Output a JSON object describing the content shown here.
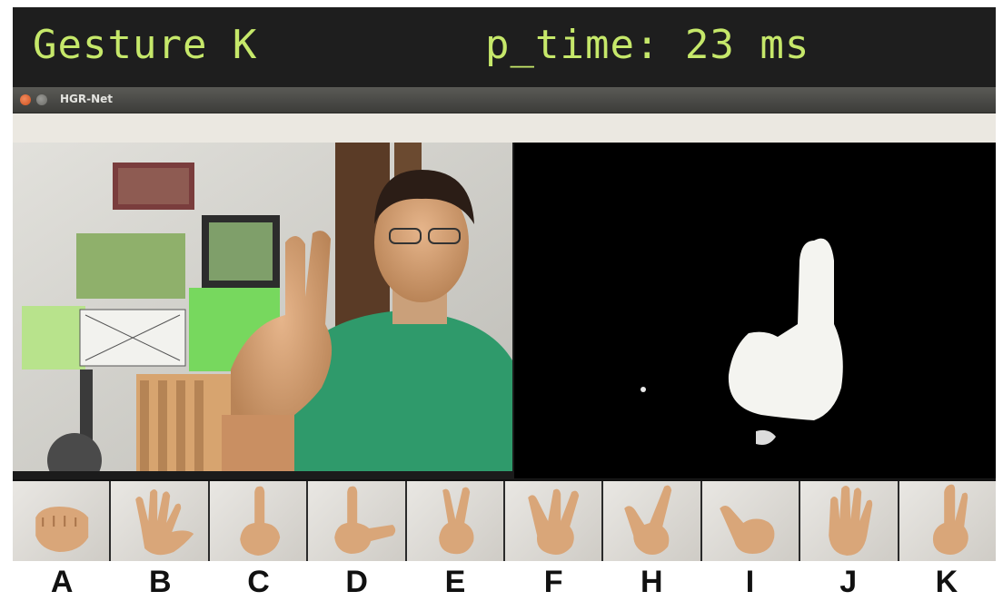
{
  "status": {
    "gesture_text": "Gesture K",
    "ptime_text": "p_time: 23 ms"
  },
  "window": {
    "title": "HGR-Net"
  },
  "gestures": [
    {
      "letter": "A",
      "icon": "fist-hand-icon"
    },
    {
      "letter": "B",
      "icon": "open-palm-icon"
    },
    {
      "letter": "C",
      "icon": "index-up-icon"
    },
    {
      "letter": "D",
      "icon": "l-shape-hand-icon"
    },
    {
      "letter": "E",
      "icon": "v-hand-icon"
    },
    {
      "letter": "F",
      "icon": "three-fingers-icon"
    },
    {
      "letter": "H",
      "icon": "horns-hand-icon"
    },
    {
      "letter": "I",
      "icon": "thumb-out-hand-icon"
    },
    {
      "letter": "J",
      "icon": "four-fingers-icon"
    },
    {
      "letter": "K",
      "icon": "two-fingers-up-icon"
    }
  ],
  "colors": {
    "status_text": "#c6e86a",
    "status_bg": "#1e1e1e",
    "skin": "#d9a679",
    "mask": "#ffffff"
  }
}
